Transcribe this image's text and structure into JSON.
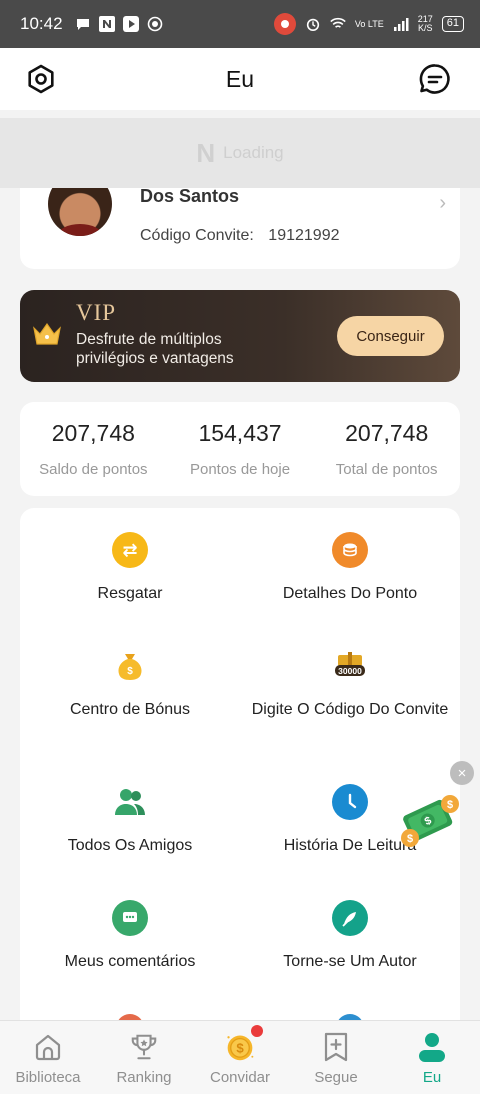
{
  "status_bar": {
    "time": "10:42",
    "network_speed": "217",
    "network_unit": "K/S",
    "lte": "Vo LTE",
    "battery": "61"
  },
  "header": {
    "title": "Eu"
  },
  "loading_banner": {
    "logo": "N",
    "text": "Loading"
  },
  "profile": {
    "name": "Dos Santos",
    "invite_label": "Código Convite:",
    "invite_code": "19121992"
  },
  "vip": {
    "title": "VIP",
    "description": "Desfrute de múltiplos privilégios e vantagens",
    "button": "Conseguir"
  },
  "stats": [
    {
      "value": "207,748",
      "label": "Saldo de pontos"
    },
    {
      "value": "154,437",
      "label": "Pontos de hoje"
    },
    {
      "value": "207,748",
      "label": "Total de pontos"
    }
  ],
  "menu": [
    {
      "label": "Resgatar",
      "icon": "exchange-icon"
    },
    {
      "label": "Detalhes Do Ponto",
      "icon": "coins-icon"
    },
    {
      "label": "Centro de Bónus",
      "icon": "money-bag-icon"
    },
    {
      "label": "Digite O Código Do Convite",
      "icon": "gift-code-icon",
      "badge": "30000"
    },
    {
      "label": "Todos Os Amigos",
      "icon": "friends-icon"
    },
    {
      "label": "História De Leitura",
      "icon": "clock-icon"
    },
    {
      "label": "Meus comentários",
      "icon": "comment-icon"
    },
    {
      "label": "Torne-se Um Autor",
      "icon": "quill-icon"
    }
  ],
  "bottom_nav": [
    {
      "label": "Biblioteca",
      "icon": "library-icon"
    },
    {
      "label": "Ranking",
      "icon": "trophy-icon"
    },
    {
      "label": "Convidar",
      "icon": "coin-icon"
    },
    {
      "label": "Segue",
      "icon": "bookmark-add-icon"
    },
    {
      "label": "Eu",
      "icon": "user-icon",
      "active": true
    }
  ],
  "colors": {
    "accent": "#13a888",
    "vip_button": "#f6d5a5",
    "vip_bg": "#2b2320"
  }
}
